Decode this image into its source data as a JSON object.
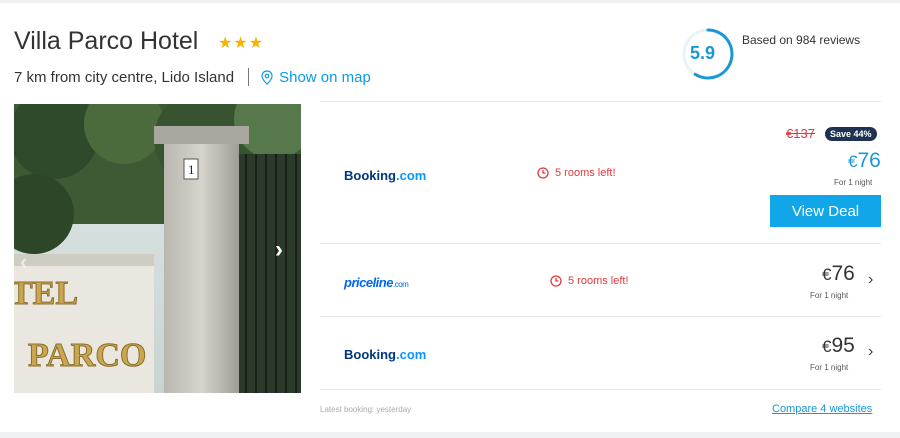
{
  "hotel": {
    "name": "Villa Parco Hotel",
    "stars": "★★★",
    "location": "7 km from city centre, Lido Island",
    "map_link": "Show on map"
  },
  "rating": {
    "score": "5.9",
    "score_fraction": 0.59,
    "reviews": "Based on 984 reviews"
  },
  "gallery": {
    "prev_icon": "‹",
    "next_icon": "›"
  },
  "offers": [
    {
      "provider": "Booking",
      "provider_suffix": ".com",
      "availability": "5 rooms left!",
      "old_price": "€137",
      "save_badge": "Save 44%",
      "currency": "€",
      "price": "76",
      "per_night": "For 1 night",
      "cta": "View Deal"
    },
    {
      "provider": "priceline",
      "provider_suffix": ".com",
      "availability": "5 rooms left!",
      "currency": "€",
      "price": "76",
      "per_night": "For 1 night"
    },
    {
      "provider": "Booking",
      "provider_suffix": ".com",
      "currency": "€",
      "price": "95",
      "per_night": "For 1 night"
    }
  ],
  "footer": {
    "latest_booking": "Latest booking: yesterday",
    "compare": "Compare 4 websites"
  },
  "colors": {
    "accent": "#1a97d6",
    "button": "#11a6e8",
    "alert": "#e0393e",
    "stars": "#f5b400"
  }
}
